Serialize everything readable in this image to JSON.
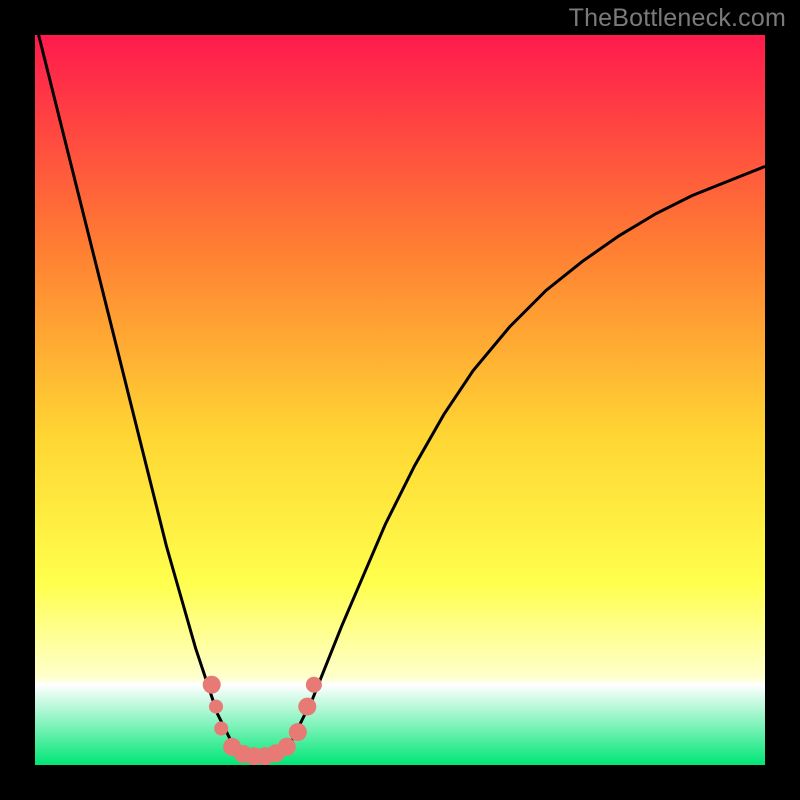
{
  "watermark": "TheBottleneck.com",
  "colors": {
    "bg_black": "#000000",
    "curve": "#000000",
    "marker_fill": "#e77a74",
    "marker_stroke": "#cc5a55",
    "grad_top": "#ff1a4d",
    "grad_mid1": "#ff7a33",
    "grad_mid2": "#ffd633",
    "grad_yellow": "#ffff4d",
    "grad_pale": "#ffffcc",
    "grad_green": "#00e676"
  },
  "chart_data": {
    "type": "line",
    "title": "",
    "xlabel": "",
    "ylabel": "",
    "xlim": [
      0,
      100
    ],
    "ylim": [
      0,
      100
    ],
    "curve": {
      "x": [
        0,
        2,
        4,
        6,
        8,
        10,
        12,
        14,
        16,
        18,
        20,
        22,
        24,
        25,
        26,
        27,
        28,
        29,
        30,
        31,
        32,
        33,
        34,
        35,
        36,
        38,
        40,
        42,
        45,
        48,
        52,
        56,
        60,
        65,
        70,
        75,
        80,
        85,
        90,
        95,
        100
      ],
      "y": [
        102,
        94,
        86,
        78,
        70,
        62,
        54,
        46,
        38,
        30,
        23,
        16,
        10,
        7,
        5,
        3,
        2,
        1.2,
        1,
        1,
        1,
        1.2,
        2,
        3,
        5,
        9,
        14,
        19,
        26,
        33,
        41,
        48,
        54,
        60,
        65,
        69,
        72.5,
        75.5,
        78,
        80,
        82
      ]
    },
    "markers": [
      {
        "x": 24.2,
        "y": 11.0,
        "r": 9
      },
      {
        "x": 24.8,
        "y": 8.0,
        "r": 7
      },
      {
        "x": 25.5,
        "y": 5.0,
        "r": 7
      },
      {
        "x": 27.0,
        "y": 2.5,
        "r": 9
      },
      {
        "x": 28.5,
        "y": 1.5,
        "r": 9
      },
      {
        "x": 30.0,
        "y": 1.2,
        "r": 9
      },
      {
        "x": 31.5,
        "y": 1.2,
        "r": 9
      },
      {
        "x": 33.0,
        "y": 1.6,
        "r": 9
      },
      {
        "x": 34.5,
        "y": 2.5,
        "r": 9
      },
      {
        "x": 36.0,
        "y": 4.5,
        "r": 9
      },
      {
        "x": 37.3,
        "y": 8.0,
        "r": 9
      },
      {
        "x": 38.2,
        "y": 11.0,
        "r": 8
      }
    ]
  }
}
